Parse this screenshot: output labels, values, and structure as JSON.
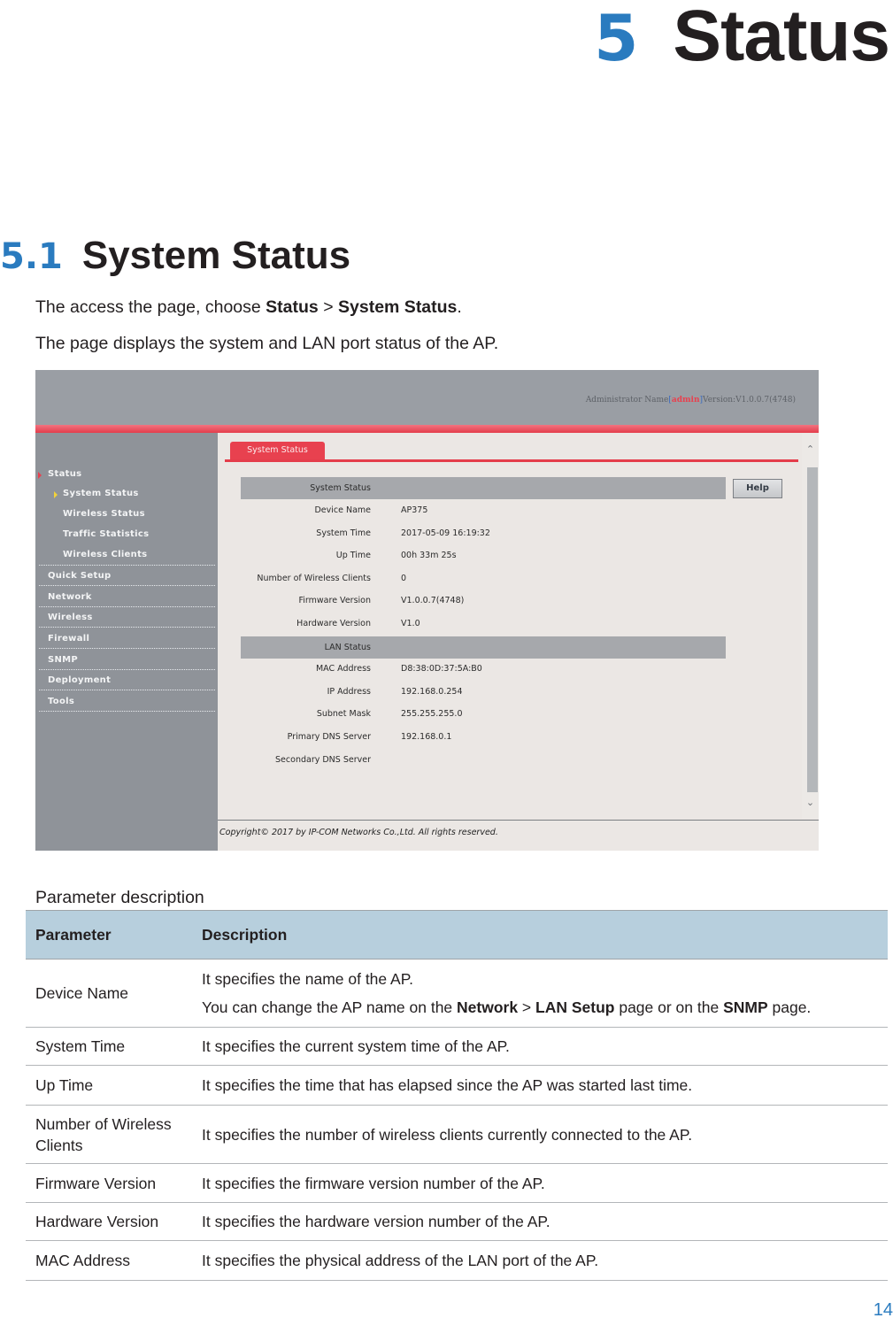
{
  "chapter": {
    "number": "5",
    "title": "Status"
  },
  "section": {
    "number": "5.1",
    "title": "System Status"
  },
  "intro": {
    "line1_prefix": "The access the page, choose ",
    "line1_menu1": "Status",
    "line1_sep": " > ",
    "line1_menu2": "System Status",
    "line1_suffix": ".",
    "line2": "The page displays the system and LAN port status of the AP."
  },
  "screenshot": {
    "header": {
      "admin_prefix": "Administrator Name",
      "admin_open": "[",
      "admin_name": "admin",
      "admin_close": "]",
      "version": "Version:V1.0.0.7(4748)"
    },
    "sidebar": {
      "status": "Status",
      "sub_items": [
        "System Status",
        "Wireless Status",
        "Traffic Statistics",
        "Wireless Clients"
      ],
      "items": [
        "Quick Setup",
        "Network",
        "Wireless",
        "Firewall",
        "SNMP",
        "Deployment",
        "Tools"
      ]
    },
    "tab": "System Status",
    "help_button": "Help",
    "system_section": {
      "title": "System Status",
      "rows": [
        {
          "label": "Device Name",
          "value": "AP375"
        },
        {
          "label": "System Time",
          "value": "2017-05-09 16:19:32"
        },
        {
          "label": "Up Time",
          "value": "00h 33m 25s"
        },
        {
          "label": "Number of Wireless Clients",
          "value": "0"
        },
        {
          "label": "Firmware Version",
          "value": "V1.0.0.7(4748)"
        },
        {
          "label": "Hardware Version",
          "value": "V1.0"
        }
      ]
    },
    "lan_section": {
      "title": "LAN Status",
      "rows": [
        {
          "label": "MAC Address",
          "value": "D8:38:0D:37:5A:B0"
        },
        {
          "label": "IP Address",
          "value": "192.168.0.254"
        },
        {
          "label": "Subnet Mask",
          "value": "255.255.255.0"
        },
        {
          "label": "Primary DNS Server",
          "value": "192.168.0.1"
        },
        {
          "label": "Secondary DNS Server",
          "value": ""
        }
      ]
    },
    "scroll": {
      "up": "^",
      "down": "v"
    },
    "copyright": "Copyright© 2017 by IP-COM Networks Co.,Ltd. All rights reserved."
  },
  "table": {
    "caption": "Parameter description",
    "headers": [
      "Parameter",
      "Description"
    ],
    "rows": [
      {
        "param": "Device Name",
        "desc1": "It specifies the name of the AP.",
        "desc2_prefix": "You can change the AP name on the ",
        "desc2_b1": "Network",
        "desc2_sep": " > ",
        "desc2_b2": "LAN Setup",
        "desc2_mid": " page or on the ",
        "desc2_b3": "SNMP",
        "desc2_suffix": " page."
      },
      {
        "param": "System Time",
        "desc": "It specifies the current system time of the AP."
      },
      {
        "param": "Up Time",
        "desc": "It specifies the time that has elapsed since the AP was started last time."
      },
      {
        "param": "Number of Wireless Clients",
        "desc": "It specifies the number of wireless clients currently connected to the AP."
      },
      {
        "param": "Firmware Version",
        "desc": "It specifies the firmware version number of the AP."
      },
      {
        "param": "Hardware Version",
        "desc": "It specifies the hardware version number of the AP."
      },
      {
        "param": "MAC Address",
        "desc": "It specifies the physical address of the LAN port of the AP."
      }
    ]
  },
  "page_number": "14",
  "colors": {
    "accent_blue": "#2a7bbf",
    "ui_red": "#e8414f",
    "table_header": "#b7cfdd"
  }
}
